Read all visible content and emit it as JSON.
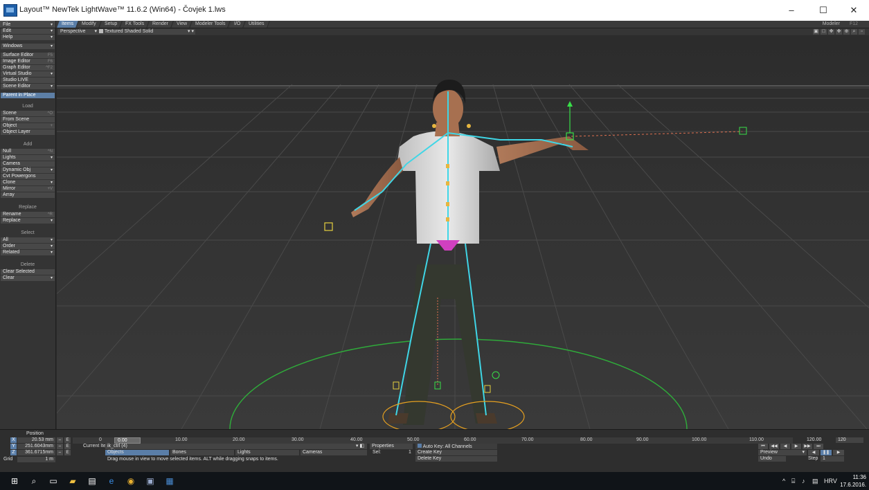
{
  "window": {
    "title": "Layout™ NewTek LightWave™ 11.6.2 (Win64) - Čovjek 1.lws",
    "minimize": "–",
    "maximize": "☐",
    "close": "✕"
  },
  "menubar": {
    "tabs": [
      "Items",
      "Modify",
      "Setup",
      "FX Tools",
      "Render",
      "View",
      "Modeler Tools",
      "I/O",
      "Utilities"
    ],
    "active_tab": "Items",
    "modeler_label": "Modeler",
    "modeler_key": "F12"
  },
  "viewport_header": {
    "view_mode": "Perspective",
    "shading": "Textured Shaded Solid"
  },
  "left_panel": {
    "file": "File",
    "edit": "Edit",
    "help": "Help",
    "windows": "Windows",
    "surface_editor": "Surface Editor",
    "surface_editor_key": "F5",
    "image_editor": "Image Editor",
    "image_editor_key": "F6",
    "graph_editor": "Graph Editor",
    "graph_editor_key": "^F2",
    "virtual_studio": "Virtual Studio",
    "studio_live": "Studio LIVE",
    "scene_editor": "Scene Editor",
    "parent_in_place": "Parent in Place",
    "load_header": "Load",
    "scene": "Scene",
    "scene_key": "^O",
    "from_scene": "From Scene",
    "object": "Object",
    "object_key": "+",
    "object_layer": "Object Layer",
    "add_header": "Add",
    "null": "Null",
    "null_key": "^N",
    "lights": "Lights",
    "camera": "Camera",
    "dynamic_obj": "Dynamic Obj",
    "cvt_powergons": "Cvt Powergons",
    "clone": "Clone",
    "mirror": "Mirror",
    "mirror_key": "+V",
    "array": "Array",
    "replace_header": "Replace",
    "rename": "Rename",
    "rename_key": "^R",
    "replace": "Replace",
    "select_header": "Select",
    "all": "All",
    "order": "Order",
    "related": "Related",
    "delete_header": "Delete",
    "clear_selected": "Clear Selected",
    "clear": "Clear"
  },
  "bottom": {
    "position_label": "Position",
    "x_axis": "X",
    "y_axis": "Y",
    "z_axis": "Z",
    "x_value": "20.53 mm",
    "y_value": "251.6043mm",
    "z_value": "361.6715mm",
    "grid_label": "Grid",
    "grid_value": "1 m",
    "current_frame": "0",
    "slider_value": "0.00",
    "timeline_ticks": [
      "10.00",
      "20.00",
      "30.00",
      "40.00",
      "50.00",
      "60.00",
      "70.00",
      "80.00",
      "90.00",
      "100.00",
      "110.00",
      "120.00"
    ],
    "end_frame": "120",
    "current_item_label": "Current Item",
    "current_item_value": "ik_ctrl (4)",
    "properties": "Properties",
    "auto_key": "Auto Key: All Channels",
    "sel_label": "Sel:",
    "sel_value": "1",
    "create_key": "Create Key",
    "delete_key": "Delete Key",
    "objects": "Objects",
    "bones": "Bones",
    "lights": "Lights",
    "cameras": "Cameras",
    "status": "Drag mouse in view to move selected items. ALT while dragging snaps to items.",
    "preview": "Preview",
    "undo": "Undo",
    "step_label": "Step",
    "step_value": "1"
  },
  "taskbar": {
    "lang": "HRV",
    "time": "11:36",
    "date": "17.6.2016."
  }
}
